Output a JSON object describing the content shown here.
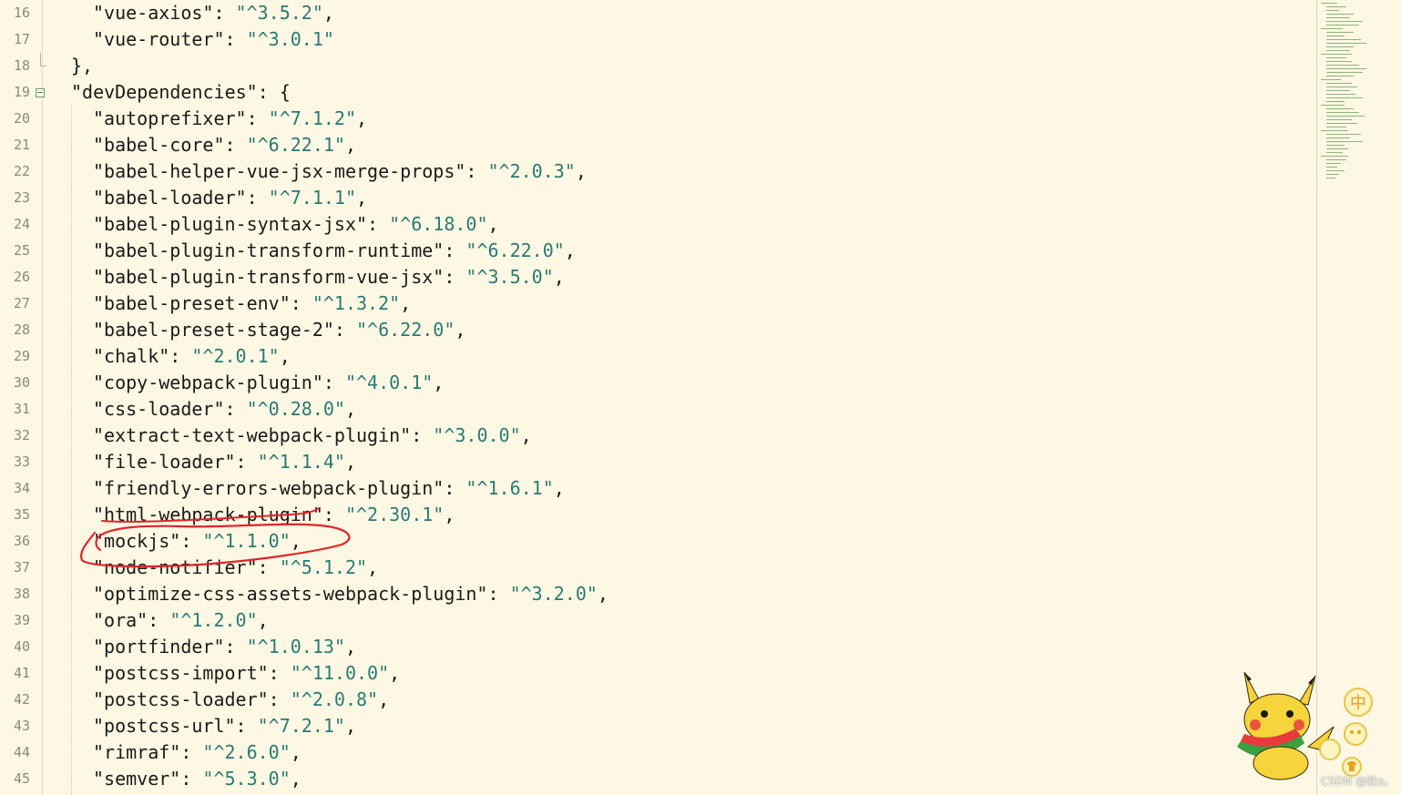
{
  "editor": {
    "lines": [
      {
        "num": "16",
        "indent": 4,
        "key": "\"vue-axios\"",
        "sep": ": ",
        "value": "\"^3.5.2\"",
        "tail": ","
      },
      {
        "num": "17",
        "indent": 4,
        "key": "\"vue-router\"",
        "sep": ": ",
        "value": "\"^3.0.1\"",
        "tail": ""
      },
      {
        "num": "18",
        "indent": 2,
        "key": "},",
        "sep": "",
        "value": "",
        "tail": ""
      },
      {
        "num": "19",
        "indent": 2,
        "key": "\"devDependencies\"",
        "sep": ": {",
        "value": "",
        "tail": ""
      },
      {
        "num": "20",
        "indent": 4,
        "key": "\"autoprefixer\"",
        "sep": ": ",
        "value": "\"^7.1.2\"",
        "tail": ","
      },
      {
        "num": "21",
        "indent": 4,
        "key": "\"babel-core\"",
        "sep": ": ",
        "value": "\"^6.22.1\"",
        "tail": ","
      },
      {
        "num": "22",
        "indent": 4,
        "key": "\"babel-helper-vue-jsx-merge-props\"",
        "sep": ": ",
        "value": "\"^2.0.3\"",
        "tail": ","
      },
      {
        "num": "23",
        "indent": 4,
        "key": "\"babel-loader\"",
        "sep": ": ",
        "value": "\"^7.1.1\"",
        "tail": ","
      },
      {
        "num": "24",
        "indent": 4,
        "key": "\"babel-plugin-syntax-jsx\"",
        "sep": ": ",
        "value": "\"^6.18.0\"",
        "tail": ","
      },
      {
        "num": "25",
        "indent": 4,
        "key": "\"babel-plugin-transform-runtime\"",
        "sep": ": ",
        "value": "\"^6.22.0\"",
        "tail": ","
      },
      {
        "num": "26",
        "indent": 4,
        "key": "\"babel-plugin-transform-vue-jsx\"",
        "sep": ": ",
        "value": "\"^3.5.0\"",
        "tail": ","
      },
      {
        "num": "27",
        "indent": 4,
        "key": "\"babel-preset-env\"",
        "sep": ": ",
        "value": "\"^1.3.2\"",
        "tail": ","
      },
      {
        "num": "28",
        "indent": 4,
        "key": "\"babel-preset-stage-2\"",
        "sep": ": ",
        "value": "\"^6.22.0\"",
        "tail": ","
      },
      {
        "num": "29",
        "indent": 4,
        "key": "\"chalk\"",
        "sep": ": ",
        "value": "\"^2.0.1\"",
        "tail": ","
      },
      {
        "num": "30",
        "indent": 4,
        "key": "\"copy-webpack-plugin\"",
        "sep": ": ",
        "value": "\"^4.0.1\"",
        "tail": ","
      },
      {
        "num": "31",
        "indent": 4,
        "key": "\"css-loader\"",
        "sep": ": ",
        "value": "\"^0.28.0\"",
        "tail": ","
      },
      {
        "num": "32",
        "indent": 4,
        "key": "\"extract-text-webpack-plugin\"",
        "sep": ": ",
        "value": "\"^3.0.0\"",
        "tail": ","
      },
      {
        "num": "33",
        "indent": 4,
        "key": "\"file-loader\"",
        "sep": ": ",
        "value": "\"^1.1.4\"",
        "tail": ","
      },
      {
        "num": "34",
        "indent": 4,
        "key": "\"friendly-errors-webpack-plugin\"",
        "sep": ": ",
        "value": "\"^1.6.1\"",
        "tail": ","
      },
      {
        "num": "35",
        "indent": 4,
        "key": "\"html-webpack-plugin\"",
        "sep": ": ",
        "value": "\"^2.30.1\"",
        "tail": ","
      },
      {
        "num": "36",
        "indent": 4,
        "key": "\"mockjs\"",
        "sep": ": ",
        "value": "\"^1.1.0\"",
        "tail": ","
      },
      {
        "num": "37",
        "indent": 4,
        "key": "\"node-notifier\"",
        "sep": ": ",
        "value": "\"^5.1.2\"",
        "tail": ","
      },
      {
        "num": "38",
        "indent": 4,
        "key": "\"optimize-css-assets-webpack-plugin\"",
        "sep": ": ",
        "value": "\"^3.2.0\"",
        "tail": ","
      },
      {
        "num": "39",
        "indent": 4,
        "key": "\"ora\"",
        "sep": ": ",
        "value": "\"^1.2.0\"",
        "tail": ","
      },
      {
        "num": "40",
        "indent": 4,
        "key": "\"portfinder\"",
        "sep": ": ",
        "value": "\"^1.0.13\"",
        "tail": ","
      },
      {
        "num": "41",
        "indent": 4,
        "key": "\"postcss-import\"",
        "sep": ": ",
        "value": "\"^11.0.0\"",
        "tail": ","
      },
      {
        "num": "42",
        "indent": 4,
        "key": "\"postcss-loader\"",
        "sep": ": ",
        "value": "\"^2.0.8\"",
        "tail": ","
      },
      {
        "num": "43",
        "indent": 4,
        "key": "\"postcss-url\"",
        "sep": ": ",
        "value": "\"^7.2.1\"",
        "tail": ","
      },
      {
        "num": "44",
        "indent": 4,
        "key": "\"rimraf\"",
        "sep": ": ",
        "value": "\"^2.6.0\"",
        "tail": ","
      },
      {
        "num": "45",
        "indent": 4,
        "key": "\"semver\"",
        "sep": ": ",
        "value": "\"^5.3.0\"",
        "tail": ","
      }
    ]
  },
  "ime": {
    "label": "中"
  },
  "watermark": "CSDN @默o。",
  "colors": {
    "background": "#fdf8e3",
    "key": "#1a1a1a",
    "value": "#2a7a75",
    "annotation": "#e0252a"
  },
  "icons": {
    "fold": "fold-toggle-icon",
    "mascot": "pikachu-mascot-icon",
    "ime": "ime-icon"
  }
}
